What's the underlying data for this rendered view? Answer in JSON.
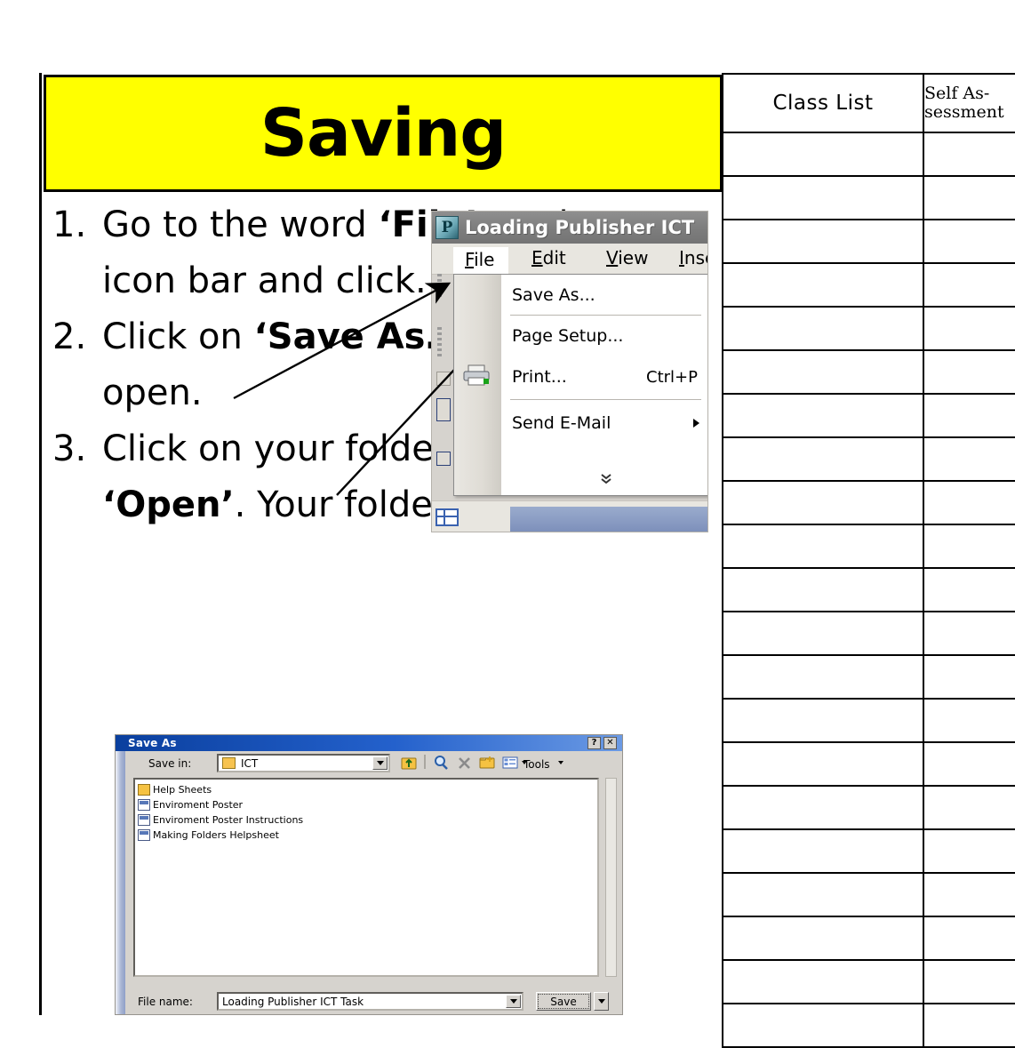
{
  "document": {
    "title": "Saving",
    "banner_color": "#FFFF00"
  },
  "steps": [
    {
      "number": "1.",
      "parts": [
        {
          "text": "Go to the word ",
          "bold": false
        },
        {
          "text": "‘File’",
          "bold": true
        },
        {
          "text": " on the top icon bar and click.",
          "bold": false
        }
      ]
    },
    {
      "number": "2.",
      "parts": [
        {
          "text": "Click on ",
          "bold": false
        },
        {
          "text": "‘Save As…’",
          "bold": true
        },
        {
          "text": "  A box will open.",
          "bold": false
        }
      ]
    },
    {
      "number": "3.",
      "parts": [
        {
          "text": "Click on your folder and click ",
          "bold": false
        },
        {
          "text": "‘Open’",
          "bold": true
        },
        {
          "text": ".  Your folder will open.",
          "bold": false
        }
      ]
    }
  ],
  "publisher_window": {
    "title": "Loading Publisher ICT",
    "app_icon": "publisher-icon",
    "menus": [
      {
        "label": "File",
        "accel": "F",
        "active": true
      },
      {
        "label": "Edit",
        "accel": "E",
        "active": false
      },
      {
        "label": "View",
        "accel": "V",
        "active": false
      },
      {
        "label": "Insert",
        "accel": "I",
        "active": false
      }
    ],
    "file_menu_items": [
      {
        "label": "Save As...",
        "shortcut": "",
        "submenu": false,
        "icon": ""
      },
      {
        "label": "Page Setup...",
        "shortcut": "",
        "submenu": false,
        "icon": ""
      },
      {
        "label": "Print...",
        "shortcut": "Ctrl+P",
        "submenu": false,
        "icon": "printer-icon"
      },
      {
        "label": "Send E-Mail",
        "shortcut": "",
        "submenu": true,
        "icon": ""
      }
    ],
    "expand_chevron": "»"
  },
  "save_as_dialog": {
    "title": "Save As",
    "help_button": "?",
    "close_button": "✕",
    "save_in_label": "Save in:",
    "save_in_value": "ICT",
    "toolbar": [
      {
        "name": "up-one-level-icon",
        "label": ""
      },
      {
        "name": "search-icon",
        "label": ""
      },
      {
        "name": "delete-icon",
        "label": ""
      },
      {
        "name": "new-folder-icon",
        "label": ""
      },
      {
        "name": "views-icon",
        "label": ""
      }
    ],
    "tools_label": "Tools",
    "files": [
      {
        "name": "Help Sheets",
        "type": "folder"
      },
      {
        "name": "Enviroment Poster",
        "type": "publisher-file"
      },
      {
        "name": "Enviroment Poster Instructions",
        "type": "publisher-file"
      },
      {
        "name": "Making Folders Helpsheet",
        "type": "publisher-file"
      }
    ],
    "file_name_label": "File name:",
    "file_name_value": "Loading Publisher ICT Task",
    "save_button": "Save"
  },
  "roster_table": {
    "headers": [
      "Class List",
      "Self As-\nsessment"
    ],
    "header_class_list": "Class List",
    "header_self_assessment_line1": "Self As-",
    "header_self_assessment_line2": "sessment",
    "row_count": 21,
    "rows": [
      [
        "",
        ""
      ],
      [
        "",
        ""
      ],
      [
        "",
        ""
      ],
      [
        "",
        ""
      ],
      [
        "",
        ""
      ],
      [
        "",
        ""
      ],
      [
        "",
        ""
      ],
      [
        "",
        ""
      ],
      [
        "",
        ""
      ],
      [
        "",
        ""
      ],
      [
        "",
        ""
      ],
      [
        "",
        ""
      ],
      [
        "",
        ""
      ],
      [
        "",
        ""
      ],
      [
        "",
        ""
      ],
      [
        "",
        ""
      ],
      [
        "",
        ""
      ],
      [
        "",
        ""
      ],
      [
        "",
        ""
      ],
      [
        "",
        ""
      ],
      [
        "",
        ""
      ]
    ]
  }
}
